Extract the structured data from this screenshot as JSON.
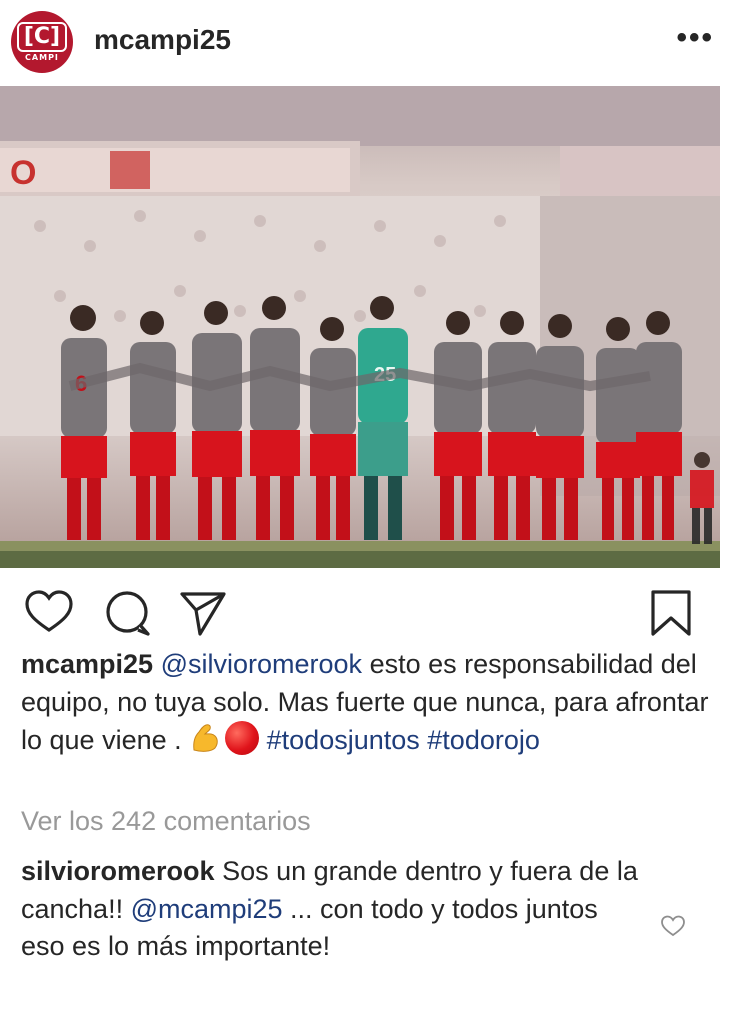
{
  "post": {
    "username": "mcampi25",
    "avatar_text": "CAMPI",
    "avatar_mark": "[C]",
    "more_icon": "more-dots-icon"
  },
  "photo": {
    "description_icon": "team-photo",
    "jersey_numbers": [
      "6",
      "25"
    ]
  },
  "actions": {
    "like_icon": "heart-icon",
    "comment_icon": "comment-bubble-icon",
    "share_icon": "paper-plane-icon",
    "save_icon": "bookmark-icon"
  },
  "caption": {
    "username": "mcampi25",
    "mention": "@silvioromerook",
    "text_1": " esto es responsabilidad del equipo, no tuya solo. Mas fuerte que nunca, para afrontar lo que viene . ",
    "emoji_1": "flexed-biceps-emoji",
    "emoji_2": "red-circle-emoji",
    "hashtag_1": "#todosjuntos",
    "hashtag_2": "#todorojo"
  },
  "view_comments": "Ver los 242 comentarios",
  "comment": {
    "username": "silvioromerook",
    "text_1": " Sos un grande dentro y fuera de la cancha!! ",
    "mention": "@mcampi25",
    "text_2": " ... con todo y todos juntos eso es lo más importante!",
    "like_icon": "small-heart-icon"
  },
  "colors": {
    "text": "#262626",
    "link": "#1f3d7a",
    "muted": "#999999",
    "avatar_bg": "#b3182e",
    "jersey": "#7a7578",
    "shorts": "#d7141d",
    "keeper": "#2fa88f"
  }
}
